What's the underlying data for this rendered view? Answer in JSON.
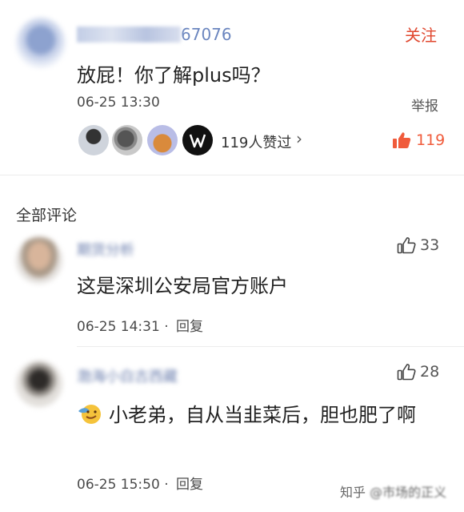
{
  "post": {
    "username_visible_suffix": "67076",
    "follow_label": "关注",
    "content": "放屁！你了解plus吗？",
    "time": "06-25 13:30",
    "report_label": "举报",
    "likers_count_text": "119人赞过",
    "likers_chevron": "›",
    "like_count": "119"
  },
  "comments_section": {
    "title": "全部评论",
    "comments": [
      {
        "username": "期货分析",
        "likes": "33",
        "content": "这是深圳公安局官方账户",
        "time": "06-25 14:31",
        "separator": "·",
        "reply_label": "回复"
      },
      {
        "username": "渤海小白古西藏",
        "likes": "28",
        "content": "小老弟，自从当韭菜后，胆也肥了啊",
        "time": "06-25 15:50",
        "separator": "·",
        "reply_label": "回复"
      }
    ]
  },
  "watermark": {
    "site": "知乎",
    "handle": "@市场的正义"
  },
  "colors": {
    "accent_red": "#f05b3b",
    "follow_red": "#e0472e",
    "link_blue": "#6b86bf"
  }
}
